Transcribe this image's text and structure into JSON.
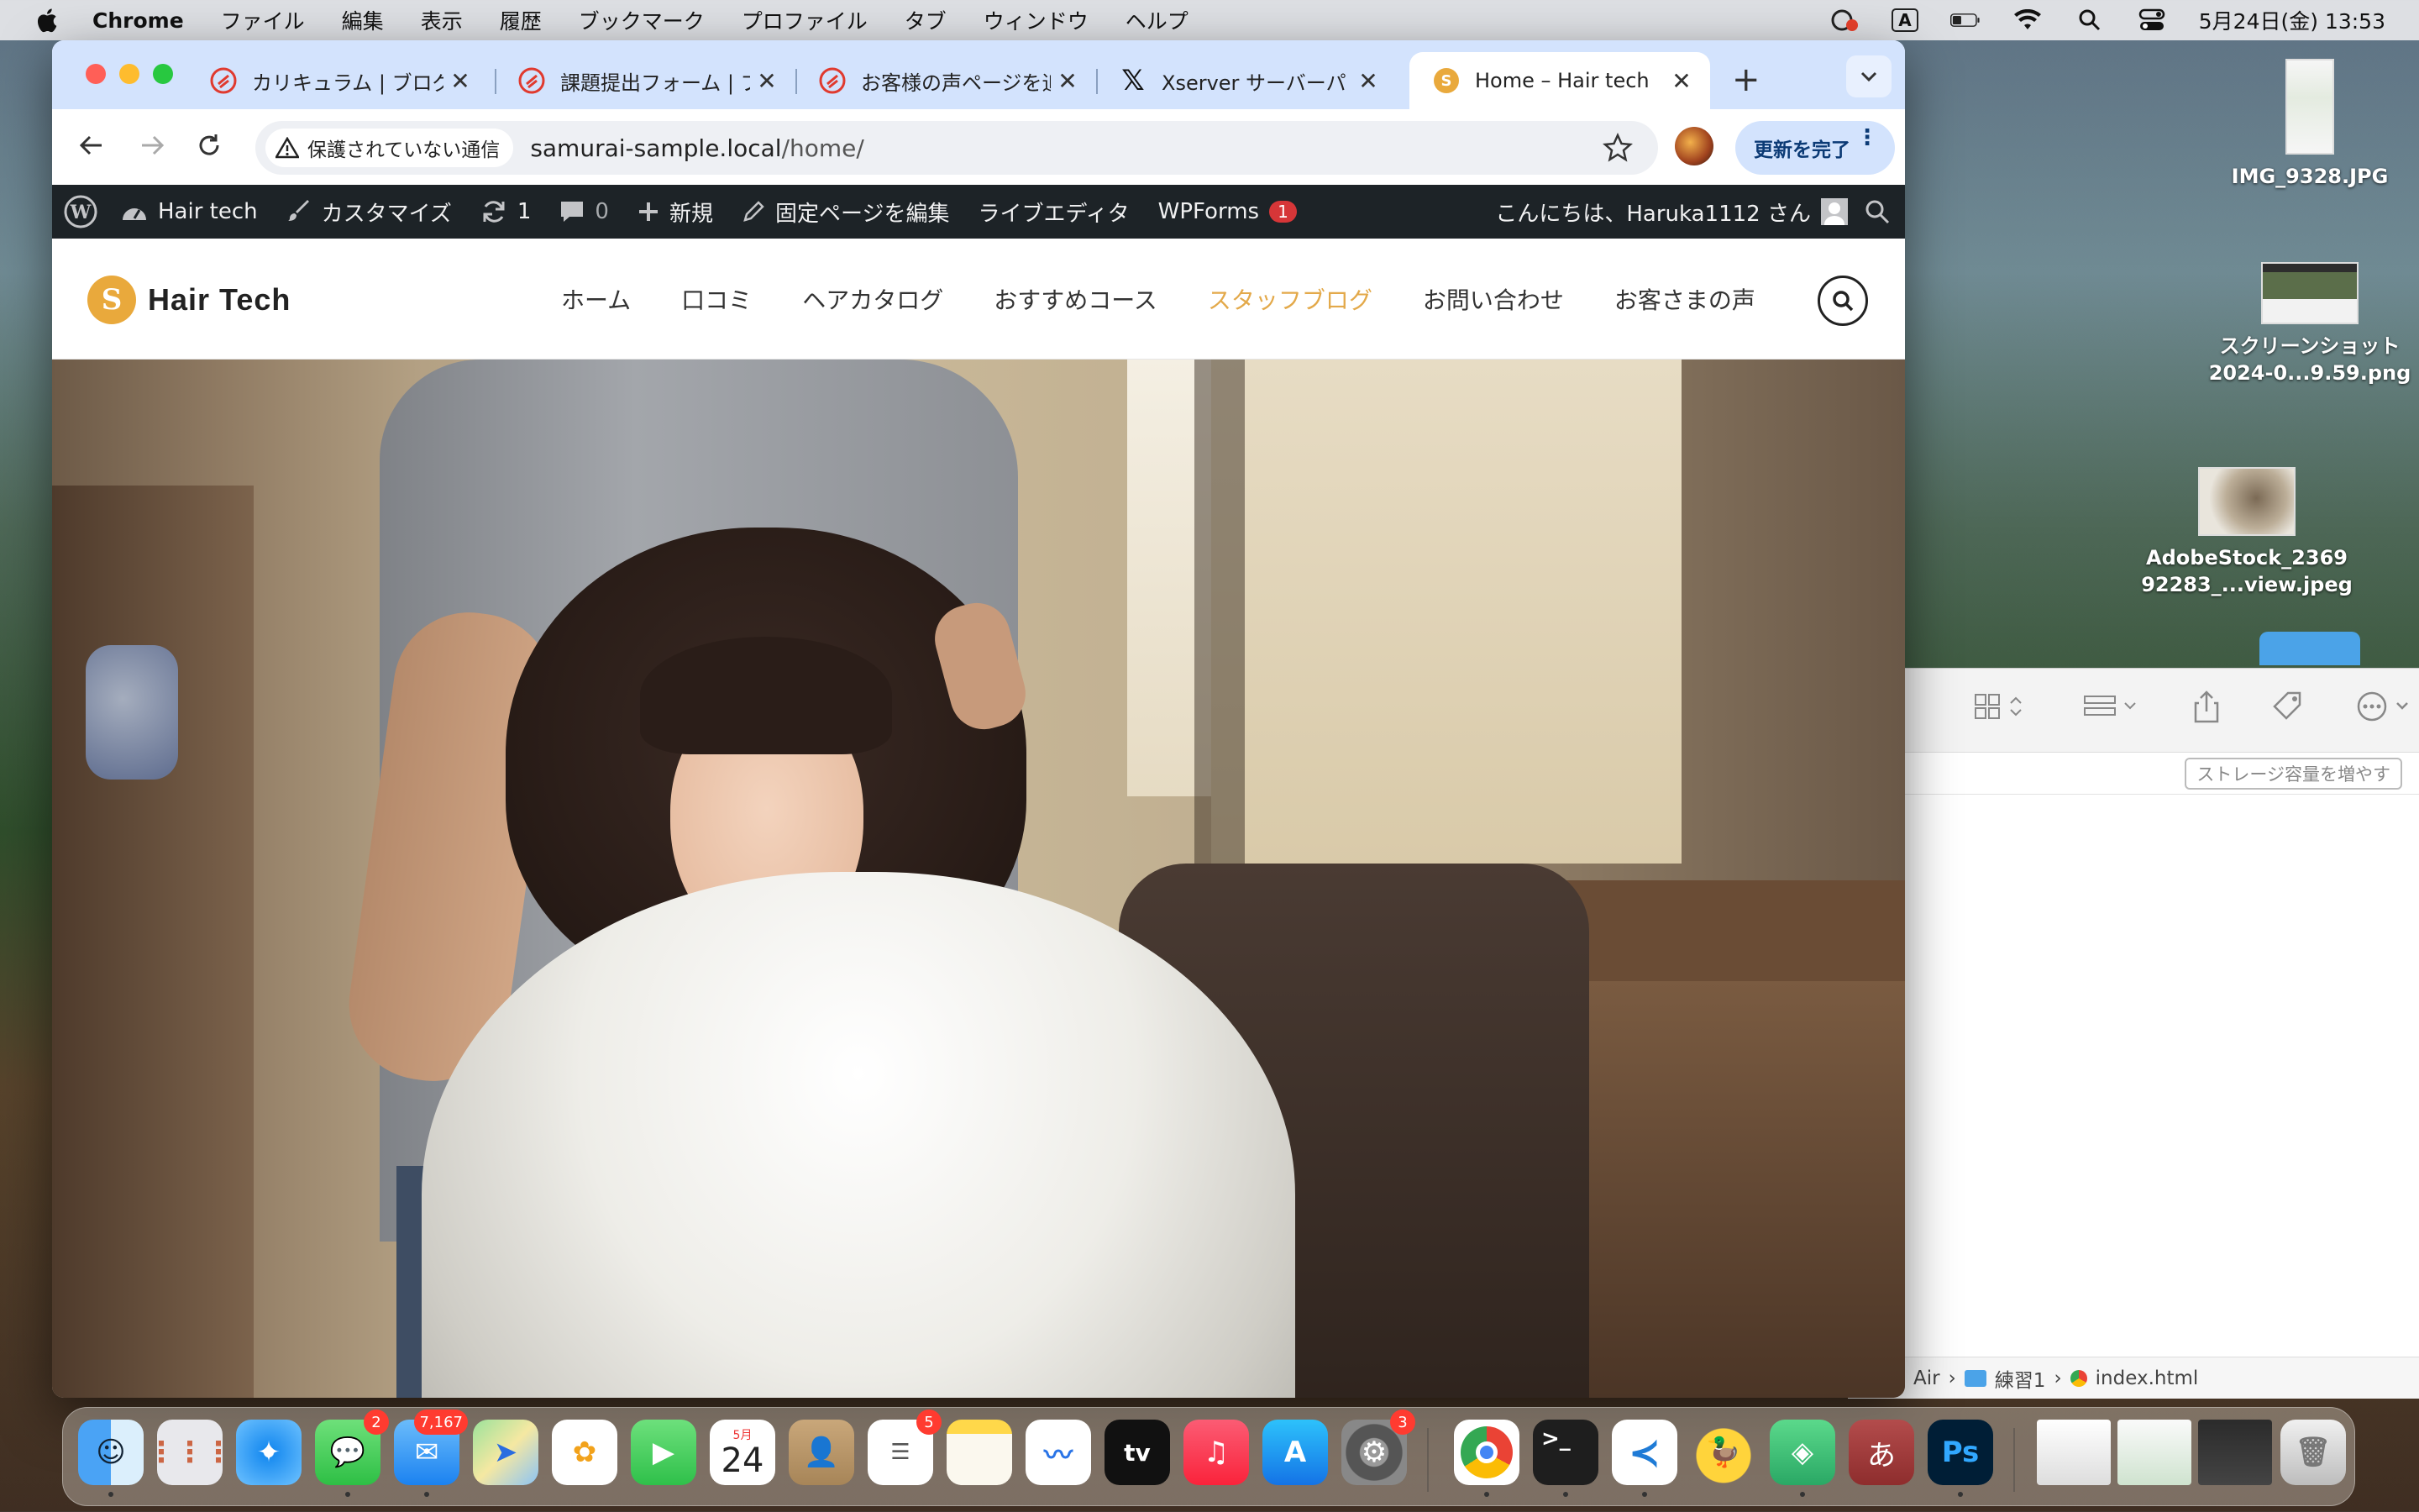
{
  "menubar": {
    "app_name": "Chrome",
    "items": [
      "ファイル",
      "編集",
      "表示",
      "履歴",
      "ブックマーク",
      "プロファイル",
      "タブ",
      "ウィンドウ",
      "ヘルプ"
    ],
    "ime": "A",
    "datetime": "5月24日(金) 13:53"
  },
  "desktop": {
    "files": [
      {
        "name": "IMG_9328.JPG"
      },
      {
        "line1": "スクリーンショット",
        "line2": "2024-0...9.59.png"
      },
      {
        "line1": "AdobeStock_2369",
        "line2": "92283_...view.jpeg"
      }
    ]
  },
  "finder": {
    "storage_button": "ストレージ容量を増やす",
    "path": [
      "Air",
      "練習1",
      "index.html"
    ]
  },
  "browser": {
    "tabs": [
      {
        "title": "カリキュラム | ブログ",
        "icon": "samurai-icon"
      },
      {
        "title": "課題提出フォーム | ブ",
        "icon": "samurai-icon"
      },
      {
        "title": "お客様の声ページを追",
        "icon": "samurai-icon"
      },
      {
        "title": "Xserver サーバーパ",
        "icon": "x-icon"
      },
      {
        "title": "Home – Hair tech",
        "icon": "site-icon"
      }
    ],
    "security_label": "保護されていない通信",
    "url_host": "samurai-sample.local",
    "url_path": "/home/",
    "update_button": "更新を完了"
  },
  "wp_admin_bar": {
    "site_name": "Hair tech",
    "customize": "カスタマイズ",
    "updates_count": "1",
    "comments_count": "0",
    "new": "新規",
    "edit_page": "固定ページを編集",
    "live_editor": "ライブエディタ",
    "wpforms": "WPForms",
    "wpforms_badge": "1",
    "greeting": "こんにちは、Haruka1112 さん"
  },
  "site": {
    "logo_text": "Hair Tech",
    "logo_mark": "S",
    "nav": [
      "ホーム",
      "口コミ",
      "ヘアカタログ",
      "おすすめコース",
      "スタッフブログ",
      "お問い合わせ",
      "お客さまの声"
    ],
    "active_nav": "スタッフブログ",
    "accent_color": "#e3a94a"
  },
  "dock": {
    "badges": {
      "messages": "2",
      "mail": "7,167",
      "reminders": "5",
      "settings": "3"
    },
    "calendar_month": "5月",
    "calendar_day": "24",
    "tv_label": "tv",
    "ps_label": "Ps",
    "kana_label": "あ"
  }
}
